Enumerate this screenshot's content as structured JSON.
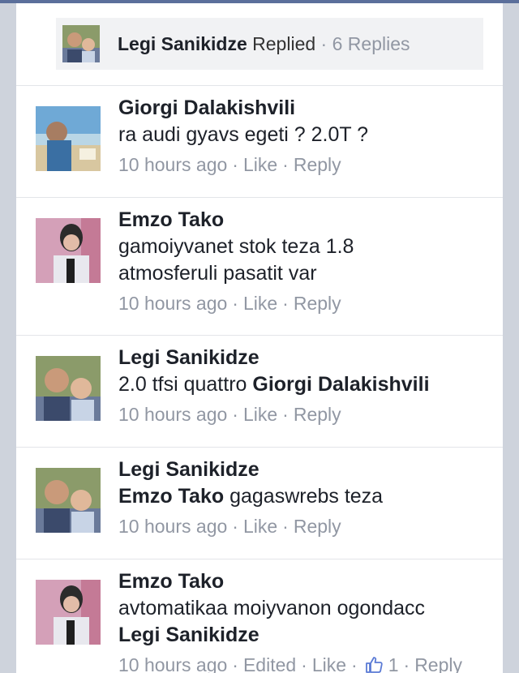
{
  "replies_summary": {
    "name": "Legi Sanikidze",
    "action": "Replied",
    "separator": "·",
    "count_text": "6 Replies"
  },
  "comments": [
    {
      "name": "Giorgi Dalakishvili",
      "text_lines": [
        "ra audi gyavs egeti ? 2.0T ?"
      ],
      "time": "10 hours ago",
      "like": "Like",
      "reply": "Reply"
    },
    {
      "name": "Emzo Tako",
      "text_lines": [
        "gamoiyvanet stok teza 1.8",
        "atmosferuli pasatit var"
      ],
      "time": "10 hours ago",
      "like": "Like",
      "reply": "Reply"
    },
    {
      "name": "Legi Sanikidze",
      "text": "2.0 tfsi quattro",
      "mention": "Giorgi Dalakishvili",
      "time": "10 hours ago",
      "like": "Like",
      "reply": "Reply"
    },
    {
      "name": "Legi Sanikidze",
      "mention": "Emzo Tako",
      "text": "gagaswrebs teza",
      "time": "10 hours ago",
      "like": "Like",
      "reply": "Reply"
    },
    {
      "name": "Emzo Tako",
      "text": "avtomatikaa moiyvanon ogondacc",
      "mention": "Legi Sanikidze",
      "time": "10 hours ago",
      "edited": "Edited",
      "like": "Like",
      "like_count": "1",
      "reply": "Reply"
    }
  ],
  "colors": {
    "card_bg": "#ffffff",
    "page_bg": "#ced3dc",
    "name_text": "#1d2129",
    "meta_text": "#9197a3",
    "like_blue": "#5b7bd5"
  }
}
